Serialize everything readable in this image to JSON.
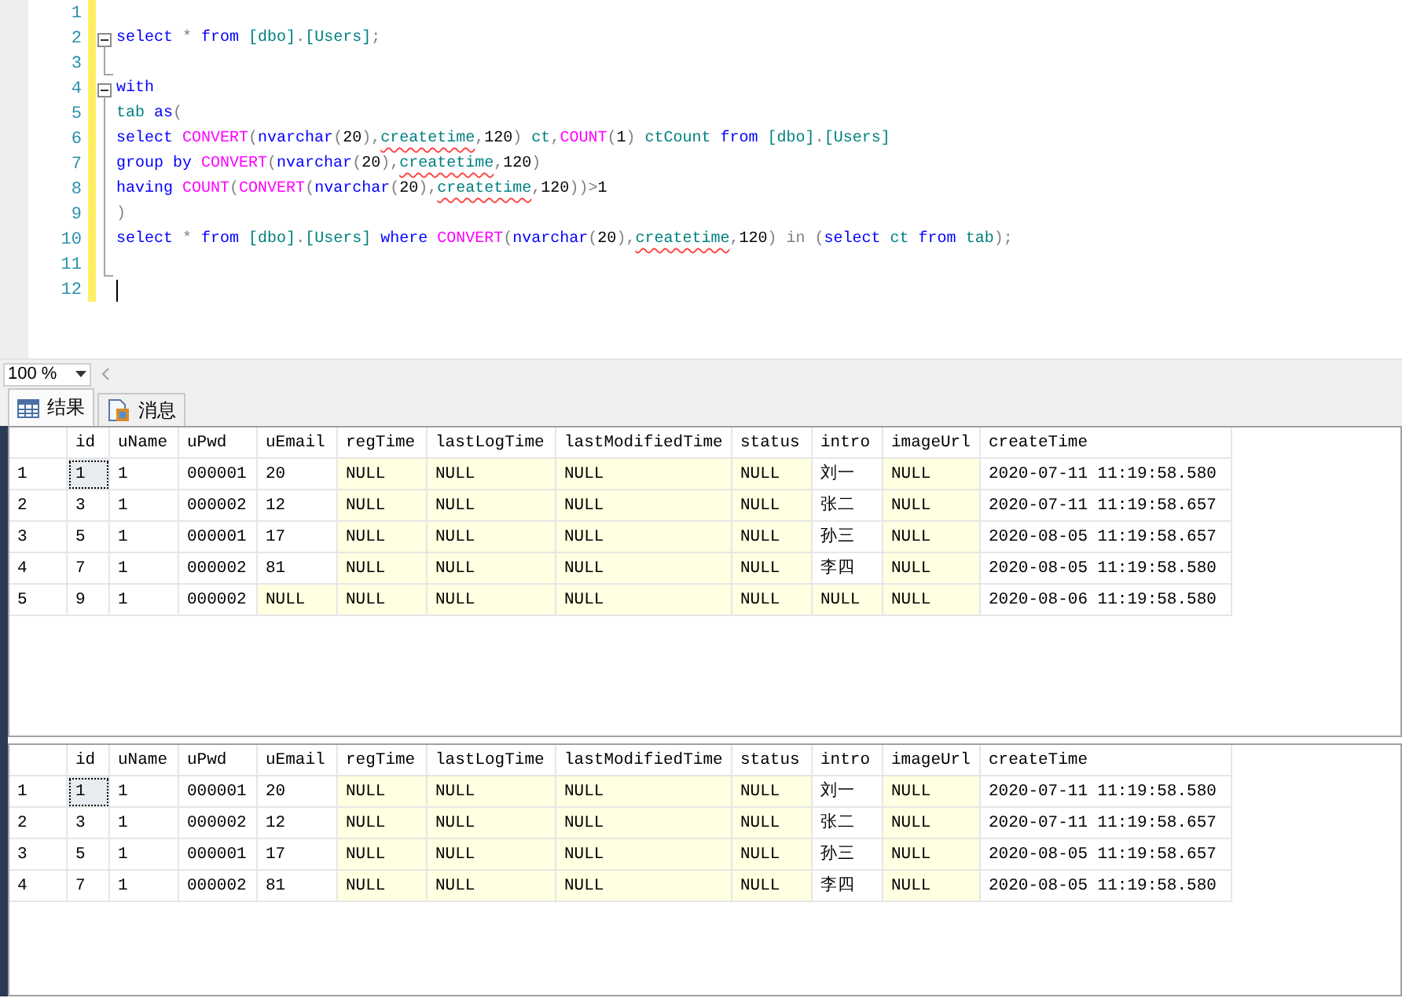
{
  "editor": {
    "lines": [
      {
        "number": "1",
        "kind": "plain",
        "cursor": false
      },
      {
        "number": "2",
        "kind": "fold_start",
        "cursor": false,
        "tokens": [
          {
            "kind": "keyword",
            "text": "select"
          },
          {
            "kind": "operator",
            "text": " * "
          },
          {
            "kind": "keyword",
            "text": "from "
          },
          {
            "kind": "identifier",
            "text": "[dbo]"
          },
          {
            "kind": "operator",
            "text": "."
          },
          {
            "kind": "identifier",
            "text": "[Users]"
          },
          {
            "kind": "operator",
            "text": ";"
          }
        ]
      },
      {
        "number": "3",
        "kind": "fold_end",
        "cursor": false
      },
      {
        "number": "4",
        "kind": "fold_start",
        "cursor": false,
        "tokens": [
          {
            "kind": "keyword",
            "text": "with"
          }
        ]
      },
      {
        "number": "5",
        "kind": "fold_body",
        "cursor": false,
        "tokens": [
          {
            "kind": "identifier",
            "text": "tab "
          },
          {
            "kind": "keyword",
            "text": "as"
          },
          {
            "kind": "operator",
            "text": "("
          }
        ]
      },
      {
        "number": "6",
        "kind": "fold_body",
        "cursor": false,
        "tokens": [
          {
            "kind": "keyword",
            "text": "select "
          },
          {
            "kind": "function",
            "text": "CONVERT"
          },
          {
            "kind": "operator",
            "text": "("
          },
          {
            "kind": "keyword",
            "text": "nvarchar"
          },
          {
            "kind": "operator",
            "text": "("
          },
          {
            "kind": "plain",
            "text": "20"
          },
          {
            "kind": "operator",
            "text": "),"
          },
          {
            "kind": "flagged",
            "text": "createtime"
          },
          {
            "kind": "operator",
            "text": ","
          },
          {
            "kind": "plain",
            "text": "120"
          },
          {
            "kind": "operator",
            "text": ") "
          },
          {
            "kind": "identifier",
            "text": "ct"
          },
          {
            "kind": "operator",
            "text": ","
          },
          {
            "kind": "function",
            "text": "COUNT"
          },
          {
            "kind": "operator",
            "text": "("
          },
          {
            "kind": "plain",
            "text": "1"
          },
          {
            "kind": "operator",
            "text": ") "
          },
          {
            "kind": "identifier",
            "text": "ctCount "
          },
          {
            "kind": "keyword",
            "text": "from "
          },
          {
            "kind": "identifier",
            "text": "[dbo]"
          },
          {
            "kind": "operator",
            "text": "."
          },
          {
            "kind": "identifier",
            "text": "[Users]"
          }
        ]
      },
      {
        "number": "7",
        "kind": "fold_body",
        "cursor": false,
        "tokens": [
          {
            "kind": "keyword",
            "text": "group by "
          },
          {
            "kind": "function",
            "text": "CONVERT"
          },
          {
            "kind": "operator",
            "text": "("
          },
          {
            "kind": "keyword",
            "text": "nvarchar"
          },
          {
            "kind": "operator",
            "text": "("
          },
          {
            "kind": "plain",
            "text": "20"
          },
          {
            "kind": "operator",
            "text": "),"
          },
          {
            "kind": "flagged",
            "text": "createtime"
          },
          {
            "kind": "operator",
            "text": ","
          },
          {
            "kind": "plain",
            "text": "120"
          },
          {
            "kind": "operator",
            "text": ")"
          }
        ]
      },
      {
        "number": "8",
        "kind": "fold_body",
        "cursor": false,
        "tokens": [
          {
            "kind": "keyword",
            "text": "having "
          },
          {
            "kind": "function",
            "text": "COUNT"
          },
          {
            "kind": "operator",
            "text": "("
          },
          {
            "kind": "function",
            "text": "CONVERT"
          },
          {
            "kind": "operator",
            "text": "("
          },
          {
            "kind": "keyword",
            "text": "nvarchar"
          },
          {
            "kind": "operator",
            "text": "("
          },
          {
            "kind": "plain",
            "text": "20"
          },
          {
            "kind": "operator",
            "text": "),"
          },
          {
            "kind": "flagged",
            "text": "createtime"
          },
          {
            "kind": "operator",
            "text": ","
          },
          {
            "kind": "plain",
            "text": "120"
          },
          {
            "kind": "operator",
            "text": "))>"
          },
          {
            "kind": "plain",
            "text": "1"
          }
        ]
      },
      {
        "number": "9",
        "kind": "fold_body",
        "cursor": false,
        "tokens": [
          {
            "kind": "operator",
            "text": ")"
          }
        ]
      },
      {
        "number": "10",
        "kind": "fold_body",
        "cursor": false,
        "tokens": [
          {
            "kind": "keyword",
            "text": "select"
          },
          {
            "kind": "operator",
            "text": " * "
          },
          {
            "kind": "keyword",
            "text": "from "
          },
          {
            "kind": "identifier",
            "text": "[dbo]"
          },
          {
            "kind": "operator",
            "text": "."
          },
          {
            "kind": "identifier",
            "text": "[Users] "
          },
          {
            "kind": "keyword",
            "text": "where "
          },
          {
            "kind": "function",
            "text": "CONVERT"
          },
          {
            "kind": "operator",
            "text": "("
          },
          {
            "kind": "keyword",
            "text": "nvarchar"
          },
          {
            "kind": "operator",
            "text": "("
          },
          {
            "kind": "plain",
            "text": "20"
          },
          {
            "kind": "operator",
            "text": "),"
          },
          {
            "kind": "flagged",
            "text": "createtime"
          },
          {
            "kind": "operator",
            "text": ","
          },
          {
            "kind": "plain",
            "text": "120"
          },
          {
            "kind": "operator",
            "text": ") in ("
          },
          {
            "kind": "keyword",
            "text": "select "
          },
          {
            "kind": "identifier",
            "text": "ct "
          },
          {
            "kind": "keyword",
            "text": "from "
          },
          {
            "kind": "identifier",
            "text": "tab"
          },
          {
            "kind": "operator",
            "text": ");"
          }
        ]
      },
      {
        "number": "11",
        "kind": "fold_end",
        "cursor": false
      },
      {
        "number": "12",
        "kind": "plain",
        "cursor": true
      }
    ]
  },
  "zoom": {
    "value": "100 %"
  },
  "tabs": [
    {
      "label": "结果",
      "kind": "grid",
      "selected": true
    },
    {
      "label": "消息",
      "kind": "message",
      "selected": false
    }
  ],
  "grids": [
    {
      "columns": [
        "id",
        "uName",
        "uPwd",
        "uEmail",
        "regTime",
        "lastLogTime",
        "lastModifiedTime",
        "status",
        "intro",
        "imageUrl",
        "createTime"
      ],
      "rows": [
        {
          "row_number": "1",
          "cells": [
            {
              "text": "1",
              "null": false,
              "selected": true
            },
            {
              "text": "1",
              "null": false,
              "selected": false
            },
            {
              "text": "000001",
              "null": false,
              "selected": false
            },
            {
              "text": "20",
              "null": false,
              "selected": false
            },
            {
              "text": "NULL",
              "null": true,
              "selected": false
            },
            {
              "text": "NULL",
              "null": true,
              "selected": false
            },
            {
              "text": "NULL",
              "null": true,
              "selected": false
            },
            {
              "text": "NULL",
              "null": true,
              "selected": false
            },
            {
              "text": "刘一",
              "null": false,
              "selected": false
            },
            {
              "text": "NULL",
              "null": true,
              "selected": false
            },
            {
              "text": "2020-07-11 11:19:58.580",
              "null": false,
              "selected": false
            }
          ]
        },
        {
          "row_number": "2",
          "cells": [
            {
              "text": "3",
              "null": false,
              "selected": false
            },
            {
              "text": "1",
              "null": false,
              "selected": false
            },
            {
              "text": "000002",
              "null": false,
              "selected": false
            },
            {
              "text": "12",
              "null": false,
              "selected": false
            },
            {
              "text": "NULL",
              "null": true,
              "selected": false
            },
            {
              "text": "NULL",
              "null": true,
              "selected": false
            },
            {
              "text": "NULL",
              "null": true,
              "selected": false
            },
            {
              "text": "NULL",
              "null": true,
              "selected": false
            },
            {
              "text": "张二",
              "null": false,
              "selected": false
            },
            {
              "text": "NULL",
              "null": true,
              "selected": false
            },
            {
              "text": "2020-07-11 11:19:58.657",
              "null": false,
              "selected": false
            }
          ]
        },
        {
          "row_number": "3",
          "cells": [
            {
              "text": "5",
              "null": false,
              "selected": false
            },
            {
              "text": "1",
              "null": false,
              "selected": false
            },
            {
              "text": "000001",
              "null": false,
              "selected": false
            },
            {
              "text": "17",
              "null": false,
              "selected": false
            },
            {
              "text": "NULL",
              "null": true,
              "selected": false
            },
            {
              "text": "NULL",
              "null": true,
              "selected": false
            },
            {
              "text": "NULL",
              "null": true,
              "selected": false
            },
            {
              "text": "NULL",
              "null": true,
              "selected": false
            },
            {
              "text": "孙三",
              "null": false,
              "selected": false
            },
            {
              "text": "NULL",
              "null": true,
              "selected": false
            },
            {
              "text": "2020-08-05 11:19:58.657",
              "null": false,
              "selected": false
            }
          ]
        },
        {
          "row_number": "4",
          "cells": [
            {
              "text": "7",
              "null": false,
              "selected": false
            },
            {
              "text": "1",
              "null": false,
              "selected": false
            },
            {
              "text": "000002",
              "null": false,
              "selected": false
            },
            {
              "text": "81",
              "null": false,
              "selected": false
            },
            {
              "text": "NULL",
              "null": true,
              "selected": false
            },
            {
              "text": "NULL",
              "null": true,
              "selected": false
            },
            {
              "text": "NULL",
              "null": true,
              "selected": false
            },
            {
              "text": "NULL",
              "null": true,
              "selected": false
            },
            {
              "text": "李四",
              "null": false,
              "selected": false
            },
            {
              "text": "NULL",
              "null": true,
              "selected": false
            },
            {
              "text": "2020-08-05 11:19:58.580",
              "null": false,
              "selected": false
            }
          ]
        },
        {
          "row_number": "5",
          "cells": [
            {
              "text": "9",
              "null": false,
              "selected": false
            },
            {
              "text": "1",
              "null": false,
              "selected": false
            },
            {
              "text": "000002",
              "null": false,
              "selected": false
            },
            {
              "text": "NULL",
              "null": true,
              "selected": false
            },
            {
              "text": "NULL",
              "null": true,
              "selected": false
            },
            {
              "text": "NULL",
              "null": true,
              "selected": false
            },
            {
              "text": "NULL",
              "null": true,
              "selected": false
            },
            {
              "text": "NULL",
              "null": true,
              "selected": false
            },
            {
              "text": "NULL",
              "null": true,
              "selected": false
            },
            {
              "text": "NULL",
              "null": true,
              "selected": false
            },
            {
              "text": "2020-08-06 11:19:58.580",
              "null": false,
              "selected": false
            }
          ]
        }
      ]
    },
    {
      "columns": [
        "id",
        "uName",
        "uPwd",
        "uEmail",
        "regTime",
        "lastLogTime",
        "lastModifiedTime",
        "status",
        "intro",
        "imageUrl",
        "createTime"
      ],
      "rows": [
        {
          "row_number": "1",
          "cells": [
            {
              "text": "1",
              "null": false,
              "selected": true
            },
            {
              "text": "1",
              "null": false,
              "selected": false
            },
            {
              "text": "000001",
              "null": false,
              "selected": false
            },
            {
              "text": "20",
              "null": false,
              "selected": false
            },
            {
              "text": "NULL",
              "null": true,
              "selected": false
            },
            {
              "text": "NULL",
              "null": true,
              "selected": false
            },
            {
              "text": "NULL",
              "null": true,
              "selected": false
            },
            {
              "text": "NULL",
              "null": true,
              "selected": false
            },
            {
              "text": "刘一",
              "null": false,
              "selected": false
            },
            {
              "text": "NULL",
              "null": true,
              "selected": false
            },
            {
              "text": "2020-07-11 11:19:58.580",
              "null": false,
              "selected": false
            }
          ]
        },
        {
          "row_number": "2",
          "cells": [
            {
              "text": "3",
              "null": false,
              "selected": false
            },
            {
              "text": "1",
              "null": false,
              "selected": false
            },
            {
              "text": "000002",
              "null": false,
              "selected": false
            },
            {
              "text": "12",
              "null": false,
              "selected": false
            },
            {
              "text": "NULL",
              "null": true,
              "selected": false
            },
            {
              "text": "NULL",
              "null": true,
              "selected": false
            },
            {
              "text": "NULL",
              "null": true,
              "selected": false
            },
            {
              "text": "NULL",
              "null": true,
              "selected": false
            },
            {
              "text": "张二",
              "null": false,
              "selected": false
            },
            {
              "text": "NULL",
              "null": true,
              "selected": false
            },
            {
              "text": "2020-07-11 11:19:58.657",
              "null": false,
              "selected": false
            }
          ]
        },
        {
          "row_number": "3",
          "cells": [
            {
              "text": "5",
              "null": false,
              "selected": false
            },
            {
              "text": "1",
              "null": false,
              "selected": false
            },
            {
              "text": "000001",
              "null": false,
              "selected": false
            },
            {
              "text": "17",
              "null": false,
              "selected": false
            },
            {
              "text": "NULL",
              "null": true,
              "selected": false
            },
            {
              "text": "NULL",
              "null": true,
              "selected": false
            },
            {
              "text": "NULL",
              "null": true,
              "selected": false
            },
            {
              "text": "NULL",
              "null": true,
              "selected": false
            },
            {
              "text": "孙三",
              "null": false,
              "selected": false
            },
            {
              "text": "NULL",
              "null": true,
              "selected": false
            },
            {
              "text": "2020-08-05 11:19:58.657",
              "null": false,
              "selected": false
            }
          ]
        },
        {
          "row_number": "4",
          "cells": [
            {
              "text": "7",
              "null": false,
              "selected": false
            },
            {
              "text": "1",
              "null": false,
              "selected": false
            },
            {
              "text": "000002",
              "null": false,
              "selected": false
            },
            {
              "text": "81",
              "null": false,
              "selected": false
            },
            {
              "text": "NULL",
              "null": true,
              "selected": false
            },
            {
              "text": "NULL",
              "null": true,
              "selected": false
            },
            {
              "text": "NULL",
              "null": true,
              "selected": false
            },
            {
              "text": "NULL",
              "null": true,
              "selected": false
            },
            {
              "text": "李四",
              "null": false,
              "selected": false
            },
            {
              "text": "NULL",
              "null": true,
              "selected": false
            },
            {
              "text": "2020-08-05 11:19:58.580",
              "null": false,
              "selected": false
            }
          ]
        }
      ]
    }
  ]
}
